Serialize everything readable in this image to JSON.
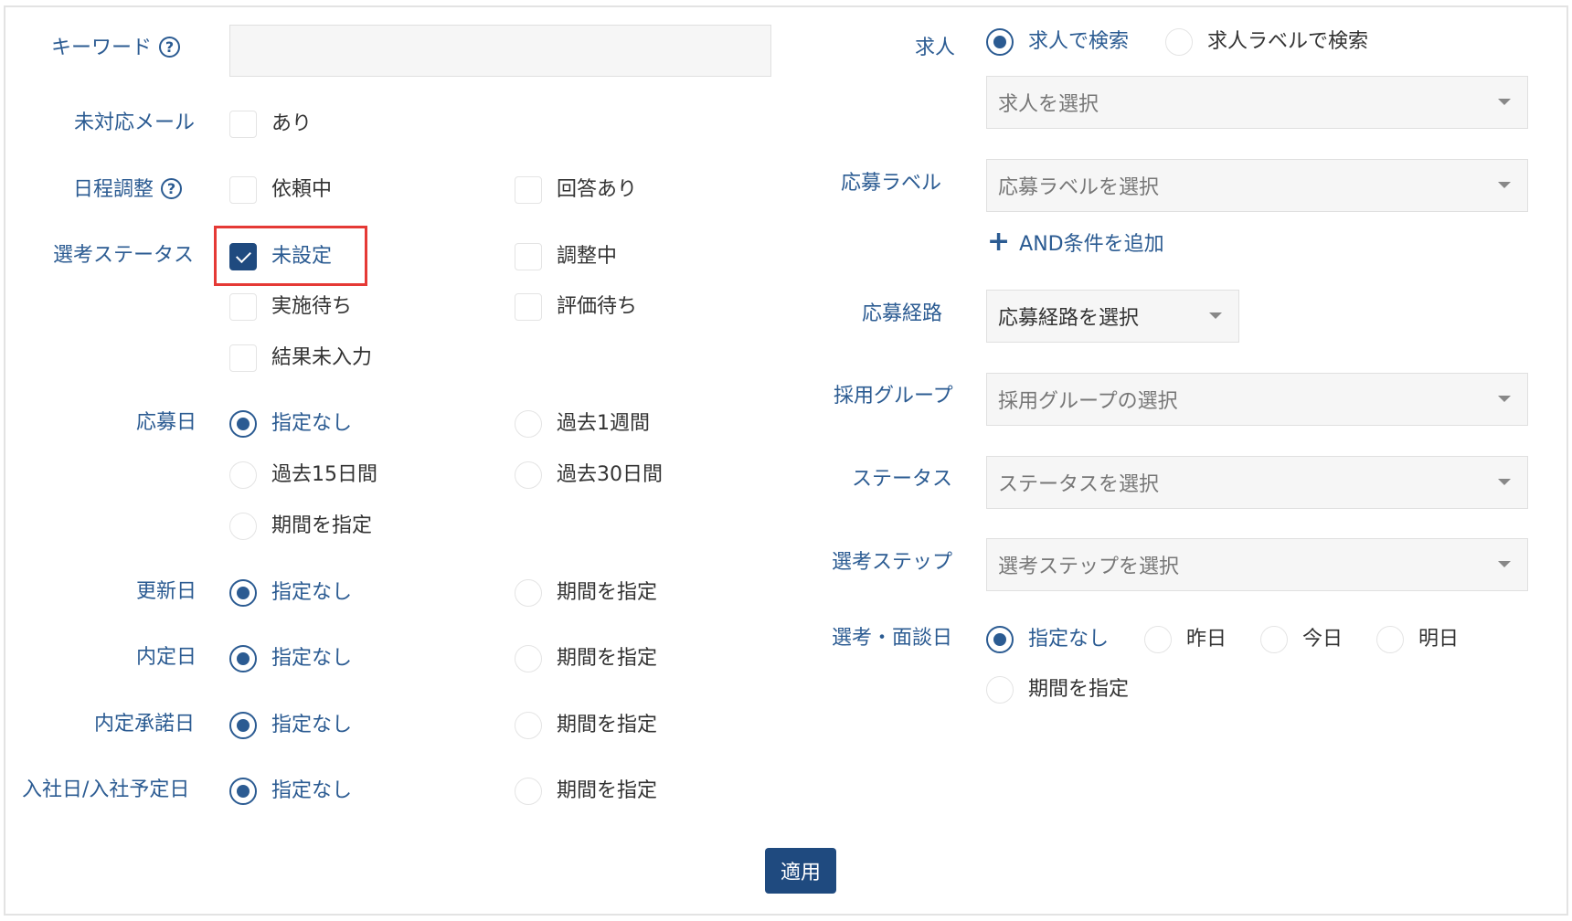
{
  "labels": {
    "keyword": "キーワード",
    "unhandled_mail": "未対応メール",
    "schedule": "日程調整",
    "selection_status": "選考ステータス",
    "applied_date": "応募日",
    "updated_date": "更新日",
    "offer_date": "内定日",
    "offer_accept_date": "内定承諾日",
    "join_date": "入社日/入社予定日",
    "job": "求人",
    "apply_label": "応募ラベル",
    "apply_route": "応募経路",
    "hiring_group": "採用グループ",
    "status": "ステータス",
    "selection_step": "選考ステップ",
    "interview_date": "選考・面談日"
  },
  "help_glyph": "?",
  "keyword_value": "",
  "unhandled_mail": {
    "option": "あり",
    "checked": false
  },
  "schedule": {
    "requesting": "依頼中",
    "answered": "回答あり"
  },
  "selection_status": {
    "unset": "未設定",
    "adjusting": "調整中",
    "waiting_execution": "実施待ち",
    "waiting_evaluation": "評価待ち",
    "no_result": "結果未入力"
  },
  "applied_date": {
    "none": "指定なし",
    "past_week": "過去1週間",
    "past_15": "過去15日間",
    "past_30": "過去30日間",
    "custom": "期間を指定"
  },
  "updated_date": {
    "none": "指定なし",
    "custom": "期間を指定"
  },
  "offer_date": {
    "none": "指定なし",
    "custom": "期間を指定"
  },
  "offer_accept_date": {
    "none": "指定なし",
    "custom": "期間を指定"
  },
  "join_date": {
    "none": "指定なし",
    "custom": "期間を指定"
  },
  "job": {
    "by_job": "求人で検索",
    "by_job_label": "求人ラベルで検索",
    "select_placeholder": "求人を選択"
  },
  "apply_label": {
    "select_placeholder": "応募ラベルを選択",
    "add_and": "AND条件を追加",
    "plus": "+"
  },
  "apply_route": {
    "select_value": "応募経路を選択"
  },
  "hiring_group": {
    "select_placeholder": "採用グループの選択"
  },
  "status": {
    "select_placeholder": "ステータスを選択"
  },
  "selection_step": {
    "select_placeholder": "選考ステップを選択"
  },
  "interview_date": {
    "none": "指定なし",
    "yesterday": "昨日",
    "today": "今日",
    "tomorrow": "明日",
    "custom": "期間を指定"
  },
  "apply_button": "適用",
  "colors": {
    "accent": "#2b5b92",
    "button": "#1f4a7f",
    "highlight": "#e53935"
  }
}
